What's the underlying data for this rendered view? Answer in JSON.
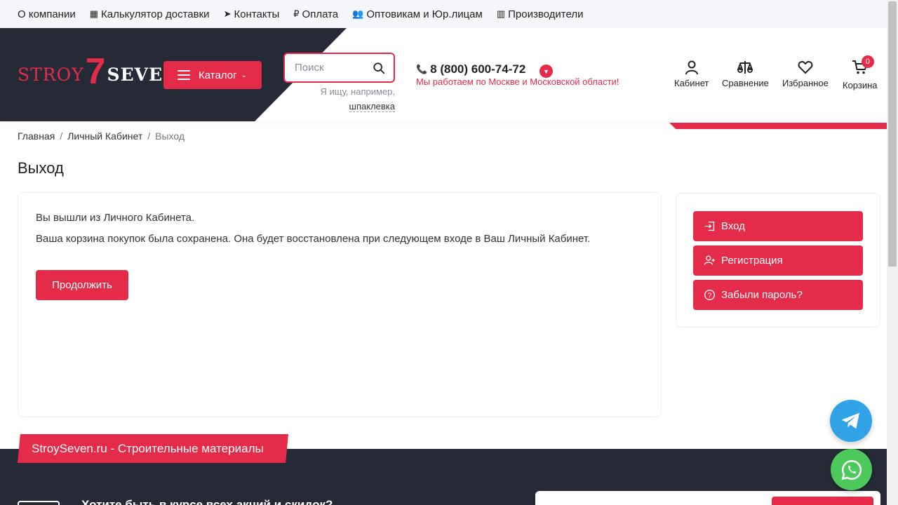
{
  "topnav": [
    {
      "icon": "",
      "label": "О компании"
    },
    {
      "icon": "calculator-icon",
      "label": "Калькулятор доставки"
    },
    {
      "icon": "location-arrow-icon",
      "label": "Контакты"
    },
    {
      "icon": "ruble-icon",
      "label": "Оплата"
    },
    {
      "icon": "users-icon",
      "label": "Оптовикам и Юр.лицам"
    },
    {
      "icon": "barcode-icon",
      "label": "Производители"
    }
  ],
  "logo": {
    "part1": "STROY",
    "digit": "7",
    "part2": "SEVEN"
  },
  "catalog_label": "Каталог",
  "search": {
    "placeholder": "Поиск",
    "hint_prefix": "Я ищу, например,",
    "hint_example": "шпаклевка"
  },
  "phone": {
    "number": "8 (800) 600-74-72",
    "region": "Мы работаем по Москве и Московской области!"
  },
  "header_icons": [
    {
      "icon": "user-icon",
      "label": "Кабинет"
    },
    {
      "icon": "scales-icon",
      "label": "Сравнение"
    },
    {
      "icon": "heart-icon",
      "label": "Избранное"
    },
    {
      "icon": "cart-icon",
      "label": "Корзина",
      "badge": "0"
    }
  ],
  "breadcrumb": {
    "home": "Главная",
    "cabinet": "Личный Кабинет",
    "current": "Выход",
    "separator": "/"
  },
  "page_title": "Выход",
  "content": {
    "line1": "Вы вышли из Личного Кабинета.",
    "line2": "Ваша корзина покупок была сохранена. Она будет восстановлена при следующем входе в Ваш Личный Кабинет.",
    "continue_label": "Продолжить"
  },
  "sidebar": {
    "login": "Вход",
    "register": "Регистрация",
    "forgot": "Забыли пароль?"
  },
  "footer": {
    "tab": "StroySeven.ru - Строительные материалы",
    "subscribe_text": "Хотите быть в курсе всех акций и скидок?"
  },
  "colors": {
    "accent": "#e52b4a",
    "dark": "#262a36",
    "telegram": "#30a3e6",
    "whatsapp": "#4cc95a"
  }
}
